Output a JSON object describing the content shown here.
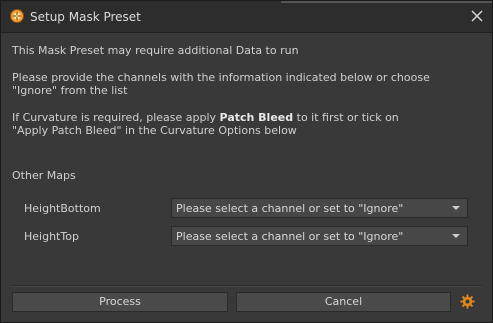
{
  "window": {
    "title": "Setup Mask Preset",
    "app_icon": "substance-painter-icon",
    "close_icon": "close-icon"
  },
  "message": {
    "line1": "This Mask Preset may require additional Data to run",
    "line2": "Please provide the channels with the information indicated below or choose",
    "line3": "\"Ignore\" from the list",
    "line4_pre": "If Curvature is required, please apply ",
    "line4_bold": "Patch Bleed",
    "line4_post": " to it first or tick on",
    "line5": "\"Apply Patch Bleed\" in the Curvature Options below"
  },
  "other_maps": {
    "label": "Other Maps",
    "rows": [
      {
        "label": "HeightBottom",
        "value": "Please select a channel or set to \"Ignore\""
      },
      {
        "label": "HeightTop",
        "value": "Please select a channel or set to \"Ignore\""
      }
    ]
  },
  "footer": {
    "process_label": "Process",
    "cancel_label": "Cancel",
    "settings_icon": "gear-icon"
  },
  "colors": {
    "background": "#393939",
    "titlebar": "#2d2d2d",
    "accent": "#e08a1e",
    "text": "#d0d0d0"
  }
}
